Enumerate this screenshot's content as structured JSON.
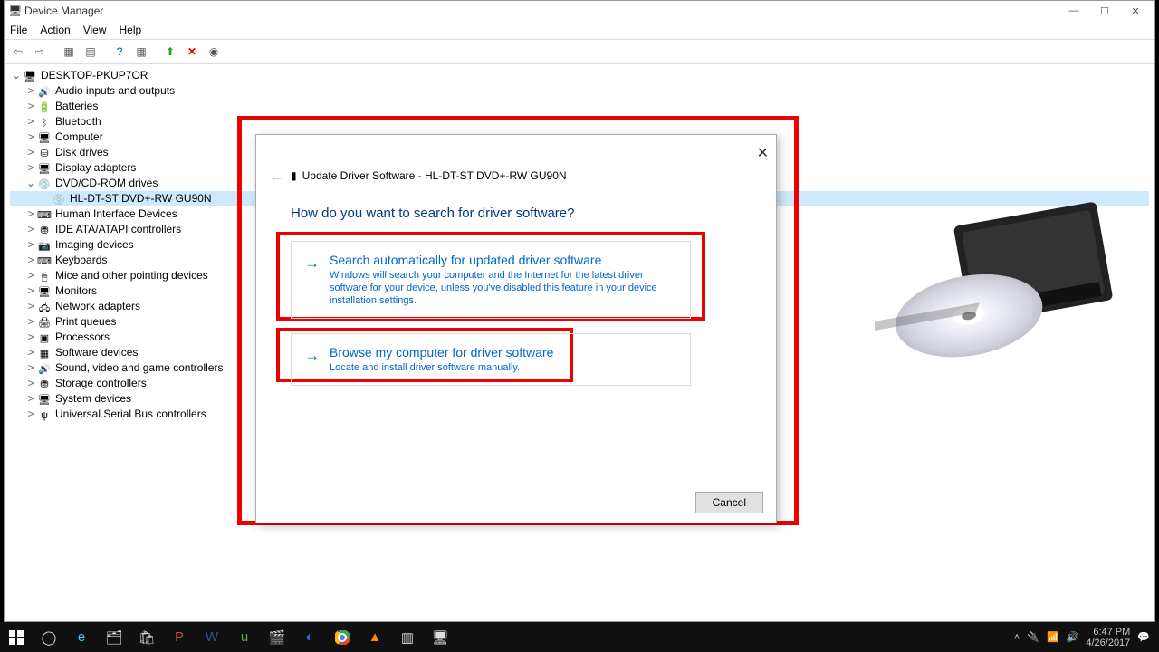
{
  "window": {
    "title": "Device Manager"
  },
  "menubar": [
    "File",
    "Action",
    "View",
    "Help"
  ],
  "tree": {
    "root": "DESKTOP-PKUP7OR",
    "items": [
      {
        "label": "Audio inputs and outputs",
        "icon": "🔊"
      },
      {
        "label": "Batteries",
        "icon": "🔋"
      },
      {
        "label": "Bluetooth",
        "icon": "ᛒ"
      },
      {
        "label": "Computer",
        "icon": "🖥"
      },
      {
        "label": "Disk drives",
        "icon": "⛁"
      },
      {
        "label": "Display adapters",
        "icon": "🖥"
      },
      {
        "label": "DVD/CD-ROM drives",
        "icon": "💿",
        "expanded": true,
        "children": [
          {
            "label": "HL-DT-ST DVD+-RW GU90N",
            "icon": "💿",
            "selected": true
          }
        ]
      },
      {
        "label": "Human Interface Devices",
        "icon": "⌨"
      },
      {
        "label": "IDE ATA/ATAPI controllers",
        "icon": "⛃"
      },
      {
        "label": "Imaging devices",
        "icon": "📷"
      },
      {
        "label": "Keyboards",
        "icon": "⌨"
      },
      {
        "label": "Mice and other pointing devices",
        "icon": "🖱"
      },
      {
        "label": "Monitors",
        "icon": "🖥"
      },
      {
        "label": "Network adapters",
        "icon": "🖧"
      },
      {
        "label": "Print queues",
        "icon": "🖨"
      },
      {
        "label": "Processors",
        "icon": "▣"
      },
      {
        "label": "Software devices",
        "icon": "▦"
      },
      {
        "label": "Sound, video and game controllers",
        "icon": "🔊"
      },
      {
        "label": "Storage controllers",
        "icon": "⛃"
      },
      {
        "label": "System devices",
        "icon": "🖥"
      },
      {
        "label": "Universal Serial Bus controllers",
        "icon": "ψ"
      }
    ]
  },
  "dialog": {
    "title": "Update Driver Software - HL-DT-ST DVD+-RW GU90N",
    "question": "How do you want to search for driver software?",
    "option1": {
      "title": "Search automatically for updated driver software",
      "desc": "Windows will search your computer and the Internet for the latest driver software for your device, unless you've disabled this feature in your device installation settings."
    },
    "option2": {
      "title": "Browse my computer for driver software",
      "desc": "Locate and install driver software manually."
    },
    "cancel": "Cancel"
  },
  "taskbar": {
    "time": "6:47 PM",
    "date": "4/26/2017"
  }
}
